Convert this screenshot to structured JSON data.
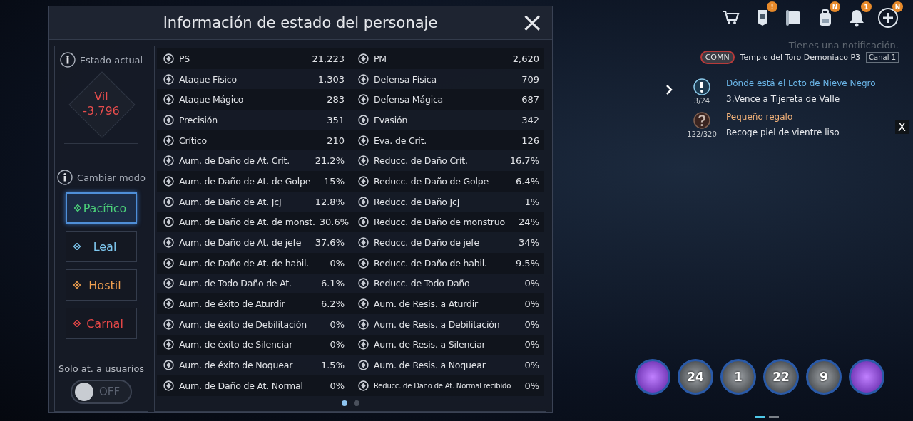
{
  "dialog": {
    "title": "Información de estado del personaje",
    "close": "×"
  },
  "status": {
    "heading": "Estado actual",
    "name": "Vil",
    "value": "-3,796"
  },
  "mode": {
    "heading": "Cambiar modo",
    "options": [
      {
        "label": "Pacífico",
        "selected": true,
        "color": "#4cd27a"
      },
      {
        "label": "Leal",
        "selected": false,
        "color": "#7fc8f0"
      },
      {
        "label": "Hostil",
        "selected": false,
        "color": "#f0a050"
      },
      {
        "label": "Carnal",
        "selected": false,
        "color": "#e84848"
      }
    ]
  },
  "toggle": {
    "label": "Solo at. a usuarios",
    "on": false,
    "text": "OFF"
  },
  "stats": [
    {
      "left": {
        "label": "PS",
        "value": "21,223"
      },
      "right": {
        "label": "PM",
        "value": "2,620"
      }
    },
    {
      "left": {
        "label": "Ataque Físico",
        "value": "1,303"
      },
      "right": {
        "label": "Defensa Física",
        "value": "709"
      }
    },
    {
      "left": {
        "label": "Ataque Mágico",
        "value": "283"
      },
      "right": {
        "label": "Defensa Mágica",
        "value": "687"
      }
    },
    {
      "left": {
        "label": "Precisión",
        "value": "351"
      },
      "right": {
        "label": "Evasión",
        "value": "342"
      }
    },
    {
      "left": {
        "label": "Crítico",
        "value": "210"
      },
      "right": {
        "label": "Eva. de Crít.",
        "value": "126"
      }
    },
    {
      "left": {
        "label": "Aum. de Daño de At. Crít.",
        "value": "21.2%"
      },
      "right": {
        "label": "Reducc. de Daño Crít.",
        "value": "16.7%"
      }
    },
    {
      "left": {
        "label": "Aum. de Daño de At. de Golpe",
        "value": "15%"
      },
      "right": {
        "label": "Reducc. de Daño de Golpe",
        "value": "6.4%"
      }
    },
    {
      "left": {
        "label": "Aum. de Daño de At. JcJ",
        "value": "12.8%"
      },
      "right": {
        "label": "Reducc. de Daño JcJ",
        "value": "1%"
      }
    },
    {
      "left": {
        "label": "Aum. de Daño de At. de monst.",
        "value": "30.6%"
      },
      "right": {
        "label": "Reducc. de Daño de monstruo",
        "value": "24%"
      }
    },
    {
      "left": {
        "label": "Aum. de Daño de At. de jefe",
        "value": "37.6%"
      },
      "right": {
        "label": "Reducc. de Daño de jefe",
        "value": "34%"
      }
    },
    {
      "left": {
        "label": "Aum. de Daño de At. de habil.",
        "value": "0%"
      },
      "right": {
        "label": "Reducc. de Daño de habil.",
        "value": "9.5%"
      }
    },
    {
      "left": {
        "label": "Aum. de Todo Daño de At.",
        "value": "6.1%"
      },
      "right": {
        "label": "Reducc. de Todo Daño",
        "value": "0%"
      }
    },
    {
      "left": {
        "label": "Aum. de éxito de Aturdir",
        "value": "6.2%"
      },
      "right": {
        "label": "Aum. de Resis. a Aturdir",
        "value": "0%"
      }
    },
    {
      "left": {
        "label": "Aum. de éxito de Debilitación",
        "value": "0%"
      },
      "right": {
        "label": "Aum. de Resis. a Debilitación",
        "value": "0%"
      }
    },
    {
      "left": {
        "label": "Aum. de éxito de Silenciar",
        "value": "0%"
      },
      "right": {
        "label": "Aum. de Resis. a Silenciar",
        "value": "0%"
      }
    },
    {
      "left": {
        "label": "Aum. de éxito de Noquear",
        "value": "1.5%"
      },
      "right": {
        "label": "Aum. de Resis. a Noquear",
        "value": "0%"
      }
    },
    {
      "left": {
        "label": "Aum. de Daño de At. Normal",
        "value": "0%"
      },
      "right": {
        "label": "Reducc. de Daño de At. Normal recibido",
        "value": "0%",
        "small": true
      }
    }
  ],
  "pages": [
    {
      "selected": true
    },
    {
      "selected": false
    }
  ],
  "hud": {
    "icons": [
      {
        "kind": "cart"
      },
      {
        "kind": "banner",
        "badge": "!"
      },
      {
        "kind": "scroll"
      },
      {
        "kind": "backpack",
        "badge": "N"
      },
      {
        "kind": "bell",
        "badge": "1"
      },
      {
        "kind": "plus",
        "badge": "N"
      }
    ],
    "notification": "Tienes una notificación.",
    "location": {
      "tag": "COMN",
      "name": "Templo del Toro Demoniaco P3",
      "channel": "Canal 1"
    },
    "quests": [
      {
        "kind": "main",
        "progress": "3/24",
        "title": "Dónde está el Loto de Nieve Negro",
        "task": "3.Vence a Tijereta de Valle"
      },
      {
        "kind": "side",
        "progress": "122/320",
        "title": "Pequeño regalo",
        "task": "Recoge piel de vientre liso"
      }
    ],
    "quest_close": "X",
    "skills": [
      {
        "kind": "purple"
      },
      {
        "kind": "grey",
        "cooldown": "24"
      },
      {
        "kind": "grey",
        "cooldown": "1"
      },
      {
        "kind": "grey",
        "cooldown": "22"
      },
      {
        "kind": "grey",
        "cooldown": "9"
      },
      {
        "kind": "purple"
      }
    ],
    "skill_pages": [
      {
        "selected": true
      },
      {
        "selected": false
      }
    ]
  }
}
